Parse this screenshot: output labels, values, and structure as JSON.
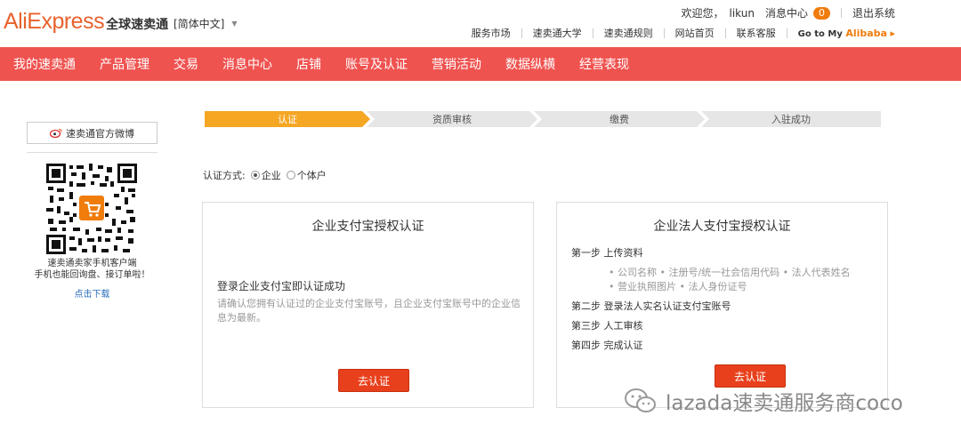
{
  "header": {
    "logo_text": "AliExpress",
    "logo_cn": "全球速卖通",
    "language": "[简体中文]",
    "welcome": "欢迎您，",
    "username": "likun",
    "messages_label": "消息中心",
    "messages_count": "0",
    "logout": "退出系统",
    "links": [
      "服务市场",
      "速卖通大学",
      "速卖通规则",
      "网站首页",
      "联系客服"
    ],
    "goto_prefix": "Go to My",
    "goto_brand": "Alibaba"
  },
  "nav": {
    "items": [
      "我的速卖通",
      "产品管理",
      "交易",
      "消息中心",
      "店铺",
      "账号及认证",
      "营销活动",
      "数据纵横",
      "经营表现"
    ]
  },
  "sidebar": {
    "weibo_label": "速卖通官方微博",
    "qr_caption_1": "速卖通卖家手机客户端",
    "qr_caption_2": "手机也能回询盘、接订单啦！",
    "download": "点击下载"
  },
  "steps": {
    "items": [
      "认证",
      "资质审核",
      "缴费",
      "入驻成功"
    ],
    "active_index": 0
  },
  "method": {
    "label": "认证方式:",
    "options": [
      "企业",
      "个体户"
    ],
    "selected": "企业"
  },
  "left_card": {
    "title": "企业支付宝授权认证",
    "label": "登录企业支付宝即认证成功",
    "desc": "请确认您拥有认证过的企业支付宝账号，且企业支付宝账号中的企业信息为最新。",
    "button": "去认证"
  },
  "right_card": {
    "title": "企业法人支付宝授权认证",
    "step1": "第一步 上传资料",
    "bullets": [
      "• 公司名称 • 注册号/统一社会信用代码 • 法人代表姓名",
      "• 营业执照图片 • 法人身份证号"
    ],
    "step2": "第二步 登录法人实名认证支付宝账号",
    "step3": "第三步 人工审核",
    "step4": "第四步 完成认证",
    "button": "去认证"
  },
  "watermark": {
    "text": "lazada速卖通服务商coco"
  },
  "colors": {
    "nav_bg": "#ef5350",
    "brand": "#e8622d",
    "step_active": "#f5a623",
    "button": "#e8401c",
    "badge": "#f07c0c"
  }
}
